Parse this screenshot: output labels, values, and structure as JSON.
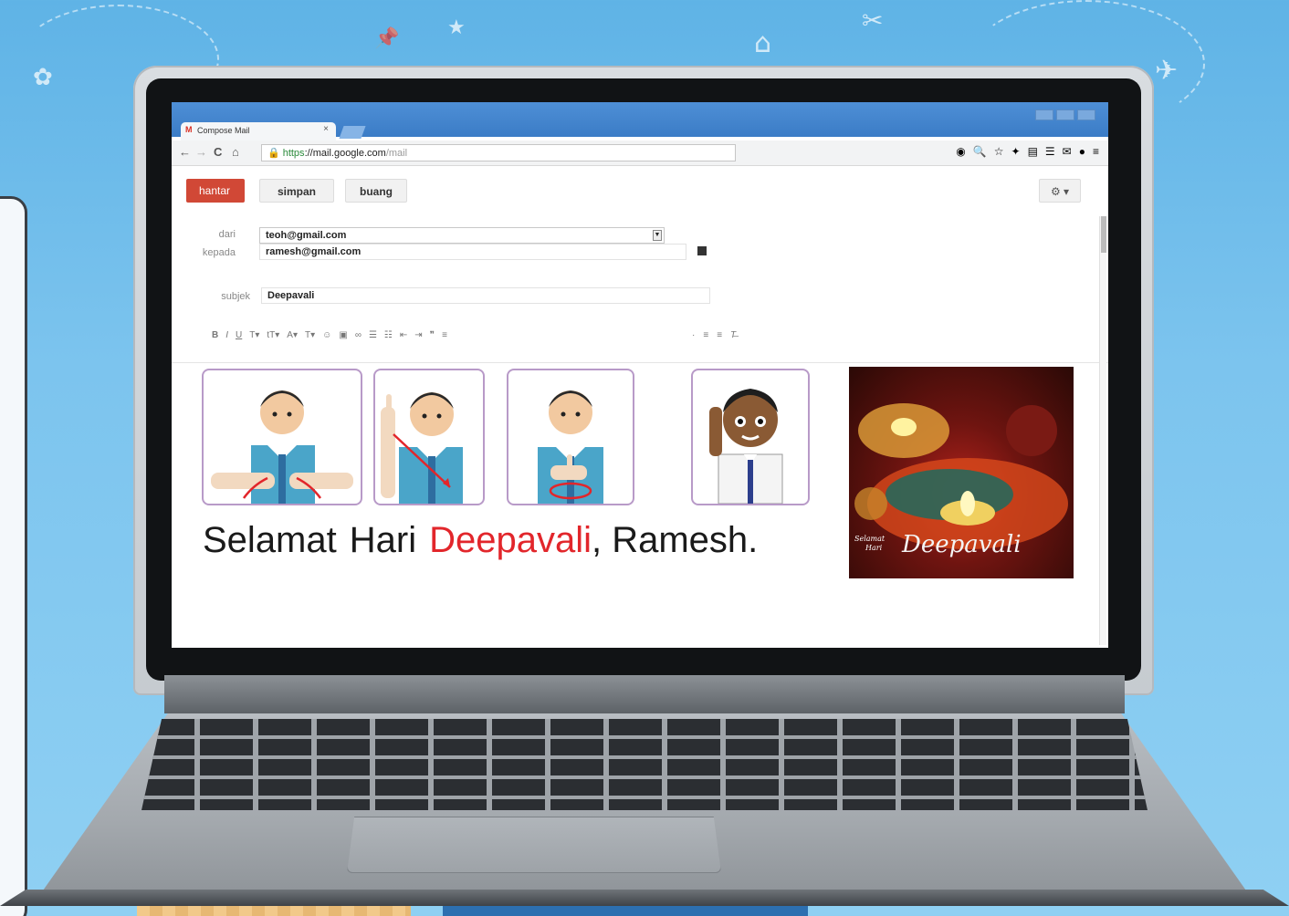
{
  "browser": {
    "tab_title": "Compose Mail",
    "tab_close": "×",
    "url_https": "https",
    "url_host": "://mail.google.com",
    "url_path": "/mail"
  },
  "toolbar": {
    "send_label": "hantar",
    "save_label": "simpan",
    "discard_label": "buang",
    "settings_label": "⚙ ▾"
  },
  "compose": {
    "from_label": "dari",
    "from_value": "teoh@gmail.com",
    "to_label": "kepada",
    "to_value": "ramesh@gmail.com",
    "subject_label": "subjek",
    "subject_value": "Deepavali"
  },
  "message": {
    "word1": "Selamat",
    "word2": "Hari",
    "word3": "Deepavali",
    "rest": ", Ramesh."
  },
  "greeting_card": {
    "line1": "Selamat",
    "line2": "Hari",
    "line3": "Deepavali"
  },
  "colors": {
    "send_button": "#d14836",
    "highlight_word": "#e2262b",
    "card_border": "#b89ac8"
  }
}
